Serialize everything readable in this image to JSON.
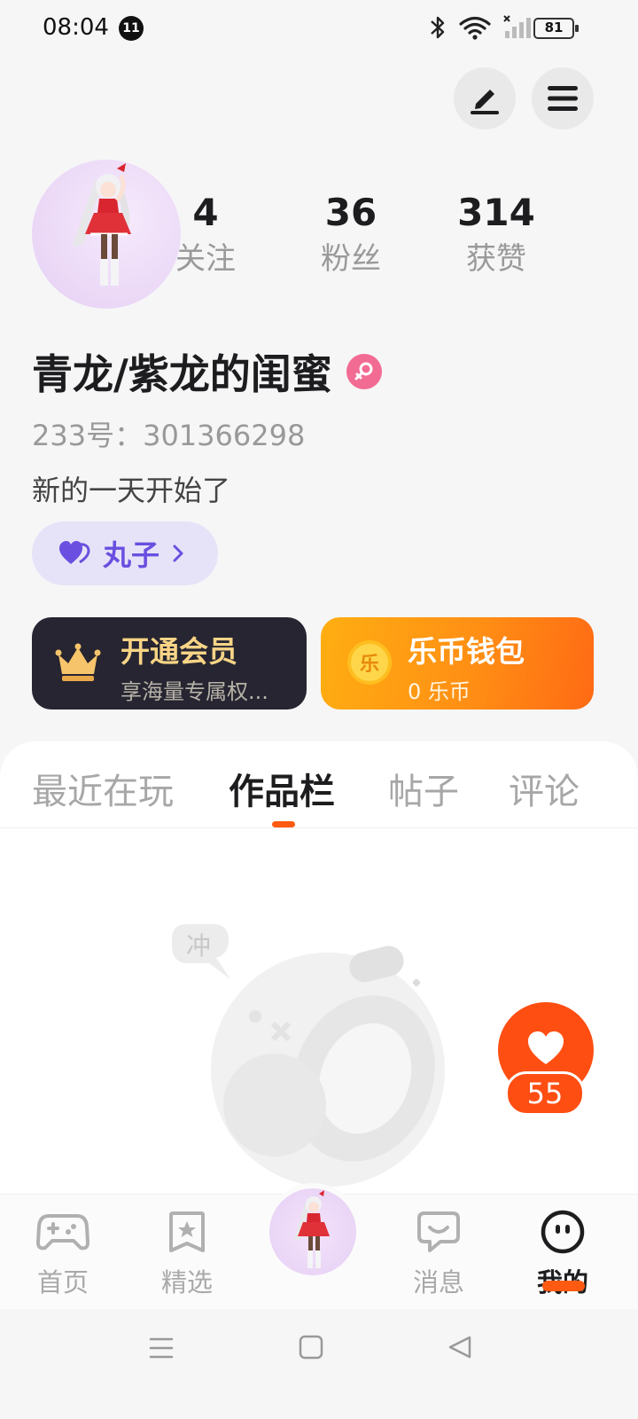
{
  "status_bar": {
    "time": "08:04",
    "notification_count": "11",
    "battery": "81",
    "icons": [
      "bluetooth-icon",
      "wifi-icon",
      "signal-icon",
      "battery-icon"
    ]
  },
  "header": {
    "edit_icon": "edit-icon",
    "menu_icon": "menu-icon"
  },
  "profile": {
    "stats": [
      {
        "value": "4",
        "label": "关注"
      },
      {
        "value": "36",
        "label": "粉丝"
      },
      {
        "value": "314",
        "label": "获赞"
      }
    ],
    "username": "青龙/紫龙的闺蜜",
    "gender": "female",
    "user_id": "233号：301366298",
    "bio": "新的一天开始了",
    "tag": "丸子"
  },
  "cards": {
    "vip": {
      "title": "开通会员",
      "subtitle": "享海量专属权..."
    },
    "wallet": {
      "title": "乐币钱包",
      "subtitle": "0 乐币",
      "coin_glyph": "乐"
    }
  },
  "tabs": [
    {
      "label": "最近在玩",
      "active": false
    },
    {
      "label": "作品栏",
      "active": true
    },
    {
      "label": "帖子",
      "active": false
    },
    {
      "label": "评论",
      "active": false
    }
  ],
  "empty_state": {
    "bubble_text": "冲"
  },
  "like_fab": {
    "count": "55"
  },
  "bottom_nav": [
    {
      "label": "首页",
      "icon": "gamepad-icon",
      "active": false
    },
    {
      "label": "精选",
      "icon": "bookmark-star-icon",
      "active": false
    },
    {
      "label": "消息",
      "icon": "chat-bubble-icon",
      "active": false
    },
    {
      "label": "我的",
      "icon": "face-icon",
      "active": true
    }
  ],
  "colors": {
    "accent": "#ff5a12",
    "tag_text": "#6a4fe0",
    "vip_bg": "#262531",
    "vip_text": "#f8d486"
  }
}
